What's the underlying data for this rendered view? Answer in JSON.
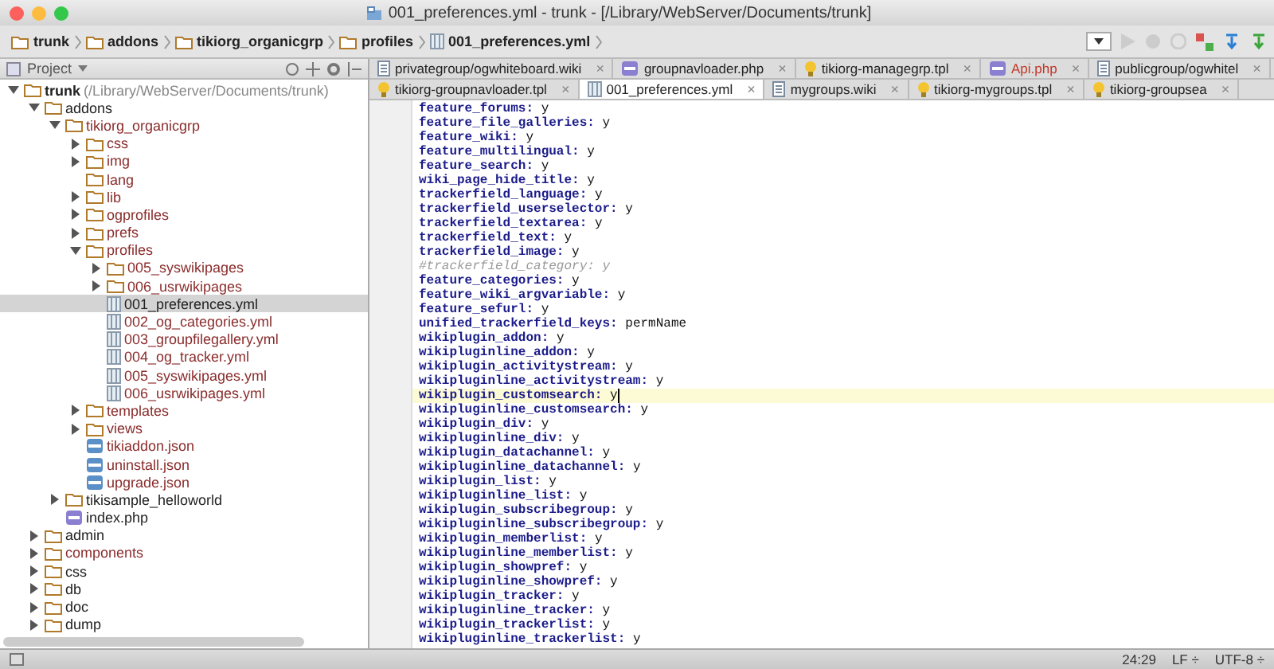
{
  "window": {
    "title": "001_preferences.yml - trunk - [/Library/WebServer/Documents/trunk]"
  },
  "breadcrumbs": [
    {
      "label": "trunk",
      "kind": "folder"
    },
    {
      "label": "addons",
      "kind": "folder"
    },
    {
      "label": "tikiorg_organicgrp",
      "kind": "folder"
    },
    {
      "label": "profiles",
      "kind": "folder"
    },
    {
      "label": "001_preferences.yml",
      "kind": "yml"
    }
  ],
  "project_panel": {
    "title": "Project",
    "tree": [
      {
        "name": "trunk",
        "hint": "(/Library/WebServer/Documents/trunk)",
        "kind": "folder",
        "expanded": true,
        "selected": false,
        "color": "#222222",
        "children": [
          {
            "name": "addons",
            "kind": "folder",
            "expanded": true,
            "selected": false,
            "color": "#222222",
            "children": [
              {
                "name": "tikiorg_organicgrp",
                "kind": "folder",
                "expanded": true,
                "selected": false,
                "color": "#8b2c2c",
                "children": [
                  {
                    "name": "css",
                    "kind": "folder",
                    "expanded": false,
                    "selected": false,
                    "color": "#8b2c2c"
                  },
                  {
                    "name": "img",
                    "kind": "folder",
                    "expanded": false,
                    "selected": false,
                    "color": "#8b2c2c"
                  },
                  {
                    "name": "lang",
                    "kind": "folder",
                    "selected": false,
                    "color": "#8b2c2c"
                  },
                  {
                    "name": "lib",
                    "kind": "folder",
                    "expanded": false,
                    "selected": false,
                    "color": "#8b2c2c"
                  },
                  {
                    "name": "ogprofiles",
                    "kind": "folder",
                    "expanded": false,
                    "selected": false,
                    "color": "#8b2c2c"
                  },
                  {
                    "name": "prefs",
                    "kind": "folder",
                    "expanded": false,
                    "selected": false,
                    "color": "#8b2c2c"
                  },
                  {
                    "name": "profiles",
                    "kind": "folder",
                    "expanded": true,
                    "selected": false,
                    "color": "#8b2c2c",
                    "children": [
                      {
                        "name": "005_syswikipages",
                        "kind": "folder",
                        "expanded": false,
                        "selected": false,
                        "color": "#8b2c2c"
                      },
                      {
                        "name": "006_usrwikipages",
                        "kind": "folder",
                        "expanded": false,
                        "selected": false,
                        "color": "#8b2c2c"
                      },
                      {
                        "name": "001_preferences.yml",
                        "kind": "yml",
                        "selected": true,
                        "color": "#222222"
                      },
                      {
                        "name": "002_og_categories.yml",
                        "kind": "yml",
                        "selected": false,
                        "color": "#8b2c2c"
                      },
                      {
                        "name": "003_groupfilegallery.yml",
                        "kind": "yml",
                        "selected": false,
                        "color": "#8b2c2c"
                      },
                      {
                        "name": "004_og_tracker.yml",
                        "kind": "yml",
                        "selected": false,
                        "color": "#8b2c2c"
                      },
                      {
                        "name": "005_syswikipages.yml",
                        "kind": "yml",
                        "selected": false,
                        "color": "#8b2c2c"
                      },
                      {
                        "name": "006_usrwikipages.yml",
                        "kind": "yml",
                        "selected": false,
                        "color": "#8b2c2c"
                      }
                    ]
                  },
                  {
                    "name": "templates",
                    "kind": "folder",
                    "expanded": false,
                    "selected": false,
                    "color": "#8b2c2c"
                  },
                  {
                    "name": "views",
                    "kind": "folder",
                    "expanded": false,
                    "selected": false,
                    "color": "#8b2c2c"
                  },
                  {
                    "name": "tikiaddon.json",
                    "kind": "json",
                    "selected": false,
                    "color": "#8b2c2c"
                  },
                  {
                    "name": "uninstall.json",
                    "kind": "json",
                    "selected": false,
                    "color": "#8b2c2c"
                  },
                  {
                    "name": "upgrade.json",
                    "kind": "json",
                    "selected": false,
                    "color": "#8b2c2c"
                  }
                ]
              },
              {
                "name": "tikisample_helloworld",
                "kind": "folder",
                "expanded": false,
                "selected": false,
                "color": "#222222"
              },
              {
                "name": "index.php",
                "kind": "php",
                "selected": false,
                "color": "#222222"
              }
            ]
          },
          {
            "name": "admin",
            "kind": "folder",
            "expanded": false,
            "selected": false,
            "color": "#222222"
          },
          {
            "name": "components",
            "kind": "folder",
            "expanded": false,
            "selected": false,
            "color": "#8b2c2c"
          },
          {
            "name": "css",
            "kind": "folder",
            "expanded": false,
            "selected": false,
            "color": "#222222"
          },
          {
            "name": "db",
            "kind": "folder",
            "expanded": false,
            "selected": false,
            "color": "#222222"
          },
          {
            "name": "doc",
            "kind": "folder",
            "expanded": false,
            "selected": false,
            "color": "#222222"
          },
          {
            "name": "dump",
            "kind": "folder",
            "expanded": false,
            "selected": false,
            "color": "#222222"
          }
        ]
      }
    ]
  },
  "tab_rows": [
    [
      {
        "label": "privategroup/ogwhiteboard.wiki",
        "kind": "wiki",
        "selected": false,
        "color": "#222222"
      },
      {
        "label": "groupnavloader.php",
        "kind": "php",
        "selected": false,
        "color": "#222222"
      },
      {
        "label": "tikiorg-managegrp.tpl",
        "kind": "tpl",
        "selected": false,
        "color": "#222222"
      },
      {
        "label": "Api.php",
        "kind": "php",
        "selected": false,
        "color": "#c0392b"
      },
      {
        "label": "publicgroup/ogwhitel",
        "kind": "wiki",
        "selected": false,
        "color": "#222222"
      }
    ],
    [
      {
        "label": "tikiorg-groupnavloader.tpl",
        "kind": "tpl",
        "selected": false,
        "color": "#222222"
      },
      {
        "label": "001_preferences.yml",
        "kind": "yml",
        "selected": true,
        "color": "#222222"
      },
      {
        "label": "mygroups.wiki",
        "kind": "wiki",
        "selected": false,
        "color": "#222222"
      },
      {
        "label": "tikiorg-mygroups.tpl",
        "kind": "tpl",
        "selected": false,
        "color": "#222222"
      },
      {
        "label": "tikiorg-groupsea",
        "kind": "tpl",
        "selected": false,
        "color": "#222222"
      }
    ]
  ],
  "close_glyph": "×",
  "editor": {
    "lines": [
      {
        "kind": "entry",
        "key": "feature_forums:",
        "value": "y",
        "current": false
      },
      {
        "kind": "entry",
        "key": "feature_file_galleries:",
        "value": "y",
        "current": false
      },
      {
        "kind": "entry",
        "key": "feature_wiki:",
        "value": "y",
        "current": false
      },
      {
        "kind": "entry",
        "key": "feature_multilingual:",
        "value": "y",
        "current": false
      },
      {
        "kind": "entry",
        "key": "feature_search:",
        "value": "y",
        "current": false
      },
      {
        "kind": "entry",
        "key": "wiki_page_hide_title:",
        "value": "y",
        "current": false
      },
      {
        "kind": "entry",
        "key": "trackerfield_language:",
        "value": "y",
        "current": false
      },
      {
        "kind": "entry",
        "key": "trackerfield_userselector:",
        "value": "y",
        "current": false
      },
      {
        "kind": "entry",
        "key": "trackerfield_textarea:",
        "value": "y",
        "current": false
      },
      {
        "kind": "entry",
        "key": "trackerfield_text:",
        "value": "y",
        "current": false
      },
      {
        "kind": "entry",
        "key": "trackerfield_image:",
        "value": "y",
        "current": false
      },
      {
        "kind": "comment",
        "text": "#trackerfield_category: y",
        "current": false
      },
      {
        "kind": "entry",
        "key": "feature_categories:",
        "value": "y",
        "current": false
      },
      {
        "kind": "entry",
        "key": "feature_wiki_argvariable:",
        "value": "y",
        "current": false
      },
      {
        "kind": "entry",
        "key": "feature_sefurl:",
        "value": "y",
        "current": false
      },
      {
        "kind": "entry",
        "key": "unified_trackerfield_keys:",
        "value": "permName",
        "current": false
      },
      {
        "kind": "entry",
        "key": "wikiplugin_addon:",
        "value": "y",
        "current": false
      },
      {
        "kind": "entry",
        "key": "wikipluginline_addon:",
        "value": "y",
        "current": false
      },
      {
        "kind": "entry",
        "key": "wikiplugin_activitystream:",
        "value": "y",
        "current": false
      },
      {
        "kind": "entry",
        "key": "wikipluginline_activitystream:",
        "value": "y",
        "current": false
      },
      {
        "kind": "entry",
        "key": "wikiplugin_customsearch:",
        "value": "y",
        "current": true
      },
      {
        "kind": "entry",
        "key": "wikipluginline_customsearch:",
        "value": "y",
        "current": false
      },
      {
        "kind": "entry",
        "key": "wikiplugin_div:",
        "value": "y",
        "current": false
      },
      {
        "kind": "entry",
        "key": "wikipluginline_div:",
        "value": "y",
        "current": false
      },
      {
        "kind": "entry",
        "key": "wikiplugin_datachannel:",
        "value": "y",
        "current": false
      },
      {
        "kind": "entry",
        "key": "wikipluginline_datachannel:",
        "value": "y",
        "current": false
      },
      {
        "kind": "entry",
        "key": "wikiplugin_list:",
        "value": "y",
        "current": false
      },
      {
        "kind": "entry",
        "key": "wikipluginline_list:",
        "value": "y",
        "current": false
      },
      {
        "kind": "entry",
        "key": "wikiplugin_subscribegroup:",
        "value": "y",
        "current": false
      },
      {
        "kind": "entry",
        "key": "wikipluginline_subscribegroup:",
        "value": "y",
        "current": false
      },
      {
        "kind": "entry",
        "key": "wikiplugin_memberlist:",
        "value": "y",
        "current": false
      },
      {
        "kind": "entry",
        "key": "wikipluginline_memberlist:",
        "value": "y",
        "current": false
      },
      {
        "kind": "entry",
        "key": "wikiplugin_showpref:",
        "value": "y",
        "current": false
      },
      {
        "kind": "entry",
        "key": "wikipluginline_showpref:",
        "value": "y",
        "current": false
      },
      {
        "kind": "entry",
        "key": "wikiplugin_tracker:",
        "value": "y",
        "current": false
      },
      {
        "kind": "entry",
        "key": "wikipluginline_tracker:",
        "value": "y",
        "current": false
      },
      {
        "kind": "entry",
        "key": "wikiplugin_trackerlist:",
        "value": "y",
        "current": false
      },
      {
        "kind": "entry",
        "key": "wikipluginline_trackerlist:",
        "value": "y",
        "current": false
      }
    ]
  },
  "status_bar": {
    "position": "24:29",
    "line_separator": "LF ÷",
    "encoding": "UTF-8 ÷"
  }
}
